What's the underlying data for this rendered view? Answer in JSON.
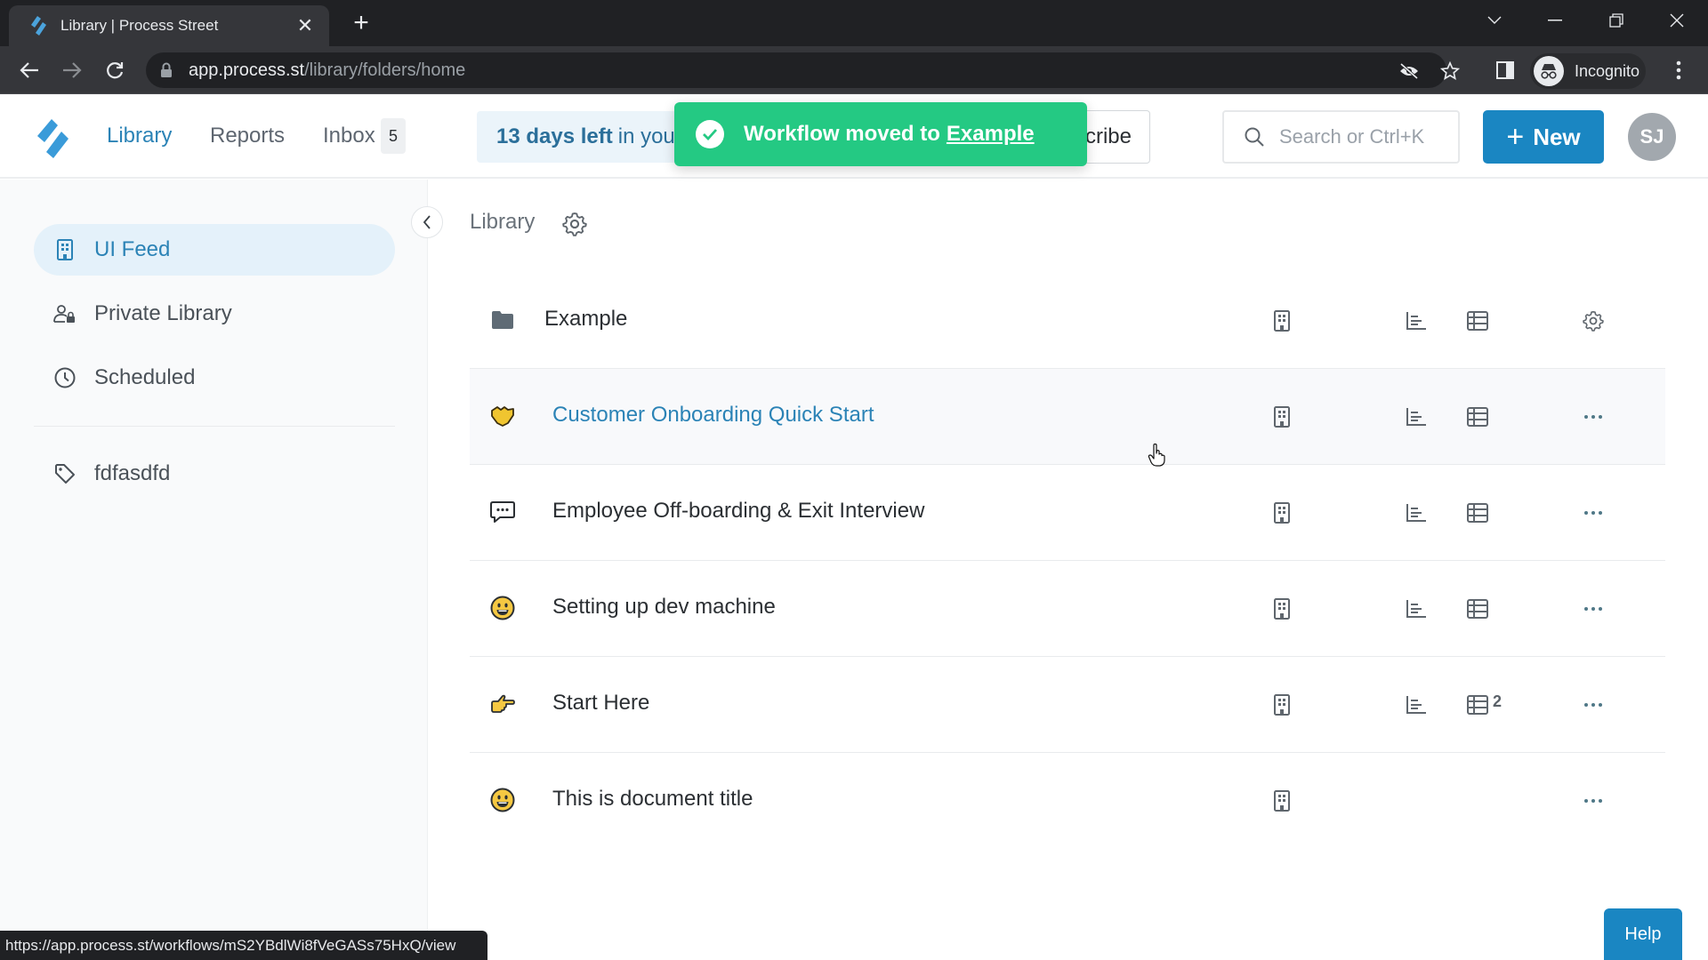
{
  "browser": {
    "tab_title": "Library | Process Street",
    "url_host": "app.process.st",
    "url_path": "/library/folders/home",
    "profile_label": "Incognito",
    "status_url": "https://app.process.st/workflows/mS2YBdlWi8fVeGASs75HxQ/view"
  },
  "header": {
    "nav": [
      {
        "label": "Library",
        "active": true
      },
      {
        "label": "Reports",
        "active": false
      },
      {
        "label": "Inbox",
        "active": false
      }
    ],
    "inbox_count": "5",
    "trial_bold": "13 days left",
    "trial_rest": "in your trial",
    "subscribe_label": "Subscribe",
    "search_placeholder": "Search or Ctrl+K",
    "new_label": "New",
    "avatar_initials": "SJ"
  },
  "toast": {
    "message": "Workflow moved to",
    "link": "Example",
    "color": "#24c983"
  },
  "sidebar": {
    "items": [
      {
        "label": "UI Feed",
        "icon": "building-icon",
        "active": true
      },
      {
        "label": "Private Library",
        "icon": "user-lock-icon",
        "active": false
      },
      {
        "label": "Scheduled",
        "icon": "clock-icon",
        "active": false
      }
    ],
    "tags": [
      {
        "label": "fdfasdfd",
        "icon": "tag-icon"
      }
    ]
  },
  "main": {
    "breadcrumb": "Library",
    "rows": [
      {
        "type": "folder",
        "title": "Example",
        "icon": "folder-icon",
        "has_reports": true,
        "has_data": true,
        "data_count": "",
        "action": "settings"
      },
      {
        "type": "workflow",
        "title": "Customer Onboarding Quick Start",
        "icon": "handshake-emoji",
        "has_reports": true,
        "has_data": true,
        "data_count": "",
        "action": "more",
        "hovered": true
      },
      {
        "type": "workflow",
        "title": "Employee Off-boarding & Exit Interview",
        "icon": "speech-bubble-icon",
        "has_reports": true,
        "has_data": true,
        "data_count": "",
        "action": "more"
      },
      {
        "type": "workflow",
        "title": "Setting up dev machine",
        "icon": "grinning-emoji",
        "has_reports": true,
        "has_data": true,
        "data_count": "",
        "action": "more"
      },
      {
        "type": "workflow",
        "title": "Start Here",
        "icon": "pointing-right-emoji",
        "has_reports": true,
        "has_data": true,
        "data_count": "2",
        "action": "more"
      },
      {
        "type": "page",
        "title": "This is document title",
        "icon": "grinning-emoji",
        "has_reports": false,
        "has_data": false,
        "data_count": "",
        "action": "more"
      }
    ]
  },
  "help_label": "Help",
  "colors": {
    "brand": "#1a86c2",
    "link": "#2b83b6",
    "toast": "#24c983",
    "sidebar_active": "#e4f1fa"
  }
}
